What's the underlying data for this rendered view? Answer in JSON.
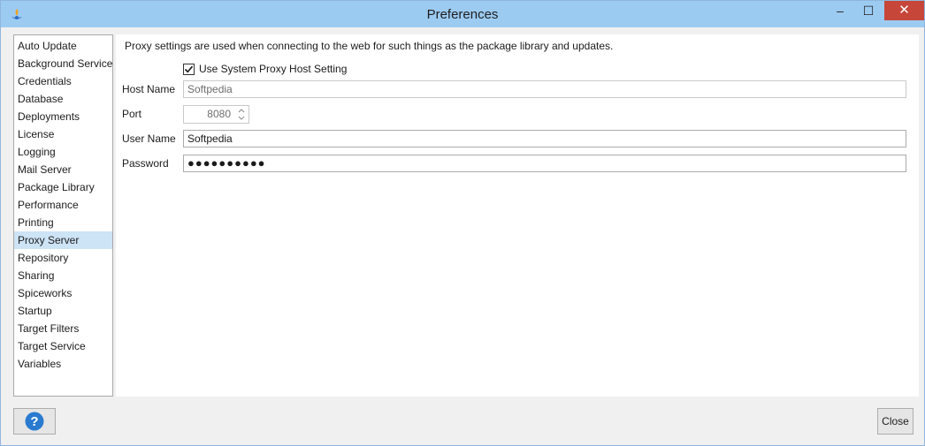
{
  "window": {
    "title": "Preferences",
    "controls": {
      "minimize": "–",
      "maximize": "☐",
      "close": "✕"
    },
    "colors": {
      "titlebar": "#9ccbf2",
      "close": "#c7463a",
      "selection": "#cde3f6",
      "help": "#2a7bd0"
    }
  },
  "nav": {
    "items": [
      {
        "label": "Auto Update"
      },
      {
        "label": "Background Service"
      },
      {
        "label": "Credentials"
      },
      {
        "label": "Database"
      },
      {
        "label": "Deployments"
      },
      {
        "label": "License"
      },
      {
        "label": "Logging"
      },
      {
        "label": "Mail Server"
      },
      {
        "label": "Package Library"
      },
      {
        "label": "Performance"
      },
      {
        "label": "Printing"
      },
      {
        "label": "Proxy Server"
      },
      {
        "label": "Repository"
      },
      {
        "label": "Sharing"
      },
      {
        "label": "Spiceworks"
      },
      {
        "label": "Startup"
      },
      {
        "label": "Target Filters"
      },
      {
        "label": "Target Service"
      },
      {
        "label": "Variables"
      }
    ],
    "selected": "Proxy Server"
  },
  "proxy": {
    "description": "Proxy settings are used when connecting to the web for such things as the package library and updates.",
    "use_system_proxy": {
      "label": "Use System Proxy Host Setting",
      "checked": true
    },
    "host_name": {
      "label": "Host Name",
      "value": "Softpedia"
    },
    "port": {
      "label": "Port",
      "value": "8080"
    },
    "user_name": {
      "label": "User Name",
      "value": "Softpedia"
    },
    "password": {
      "label": "Password",
      "value": "●●●●●●●●●●"
    }
  },
  "buttons": {
    "help_icon": "question-icon",
    "help_glyph": "?",
    "close": "Close"
  }
}
